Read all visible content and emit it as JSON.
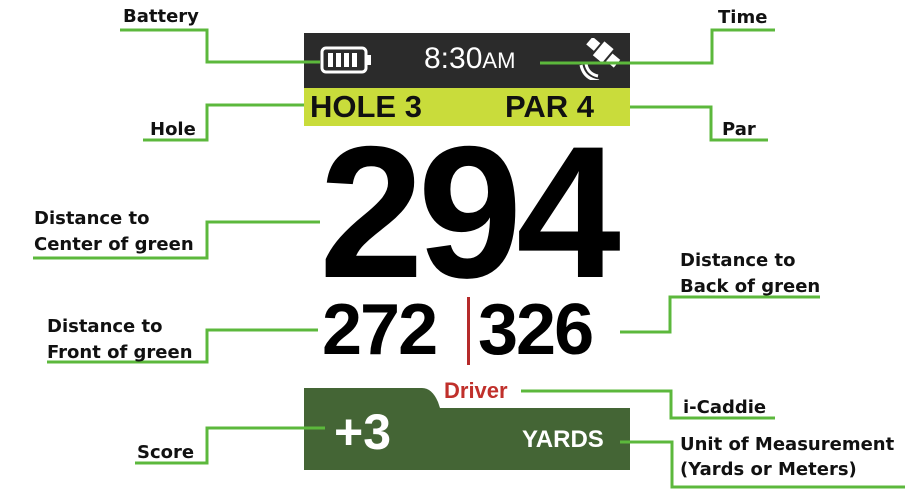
{
  "device": {
    "time": "8:30",
    "time_suffix": "AM",
    "hole": "HOLE 3",
    "par": "PAR 4",
    "center_distance": "294",
    "front_distance": "272",
    "back_distance": "326",
    "club": "Driver",
    "score": "+3",
    "unit": "YARDS"
  },
  "labels": {
    "battery": "Battery",
    "time": "Time",
    "hole": "Hole",
    "par": "Par",
    "center_line1": "Distance to",
    "center_line2": "Center of green",
    "back_line1": "Distance to",
    "back_line2": "Back of green",
    "front_line1": "Distance to",
    "front_line2": "Front of green",
    "icaddie": "i-Caddie",
    "score": "Score",
    "unit_line1": "Unit of Measurement",
    "unit_line2": "(Yards or Meters)"
  },
  "icons": {
    "battery": "battery-icon",
    "satellite": "satellite-icon"
  },
  "colors": {
    "leader_line": "#5cb83c",
    "top_bar": "#2b2b2b",
    "hole_bar": "#c9dc3b",
    "score_panel": "#446535",
    "club_text": "#c0302b",
    "divider": "#b52a2a"
  }
}
